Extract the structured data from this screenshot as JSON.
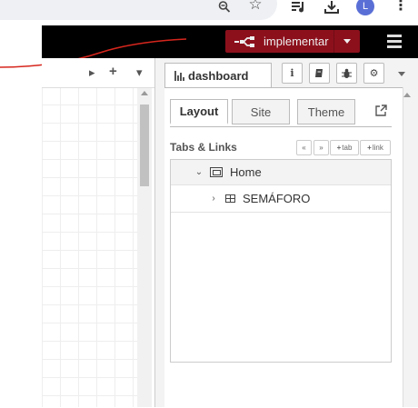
{
  "browser": {
    "avatar_letter": "L",
    "icons": [
      "zoom-icon",
      "star-icon",
      "queue-music-icon",
      "download-icon",
      "kebab-menu-icon"
    ]
  },
  "header": {
    "deploy_label": "implementar",
    "deploy_color": "#8c101c"
  },
  "workspace": {
    "icons": [
      "tab-scroll-right-icon",
      "add-flow-icon",
      "flow-menu-icon"
    ]
  },
  "sidebar": {
    "active_tab": "dashboard",
    "icons": [
      "info-icon",
      "book-icon",
      "bug-icon",
      "gear-icon",
      "chevron-down-icon"
    ]
  },
  "dashboard": {
    "tabs": [
      {
        "label": "Layout",
        "active": true
      },
      {
        "label": "Site",
        "active": false
      },
      {
        "label": "Theme",
        "active": false
      }
    ],
    "section_title": "Tabs & Links",
    "buttons": {
      "collapse": "«",
      "expand": "»",
      "add_tab": "tab",
      "add_link": "link"
    },
    "tree": [
      {
        "label": "Home",
        "type": "tab",
        "expanded": true
      },
      {
        "label": "SEMÁFORO",
        "type": "group",
        "expanded": false
      }
    ]
  },
  "annotation_color": "#d6261d"
}
